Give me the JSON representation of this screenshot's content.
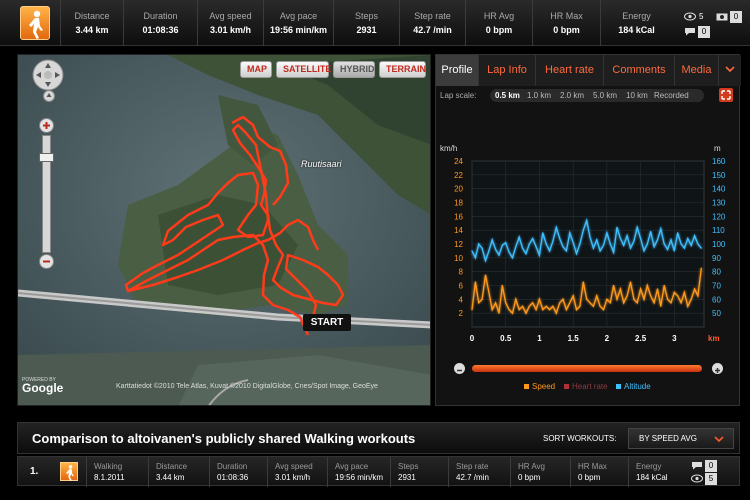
{
  "stats": [
    {
      "label": "Distance",
      "value": "3.44 km"
    },
    {
      "label": "Duration",
      "value": "01:08:36"
    },
    {
      "label": "Avg speed",
      "value": "3.01 km/h"
    },
    {
      "label": "Avg pace",
      "value": "19:56 min/km"
    },
    {
      "label": "Steps",
      "value": "2931"
    },
    {
      "label": "Step rate",
      "value": "42.7 /min"
    },
    {
      "label": "HR Avg",
      "value": "0 bpm"
    },
    {
      "label": "HR Max",
      "value": "0 bpm"
    },
    {
      "label": "Energy",
      "value": "184 kCal"
    }
  ],
  "social": {
    "views": "5",
    "photos": "0",
    "comments": "0"
  },
  "map": {
    "buttons": [
      "MAP",
      "SATELLITE",
      "HYBRID",
      "TERRAIN"
    ],
    "active_button": "HYBRID",
    "start_label": "START",
    "place_label": "Ruutisaari",
    "copyright": "Karttatiedot ©2010 Tele Atlas, Kuvat ©2010 DigitalGlobe, Cnes/Spot Image, GeoEye",
    "powered_by": "POWERED BY",
    "google": "Google"
  },
  "panel": {
    "tabs": [
      "Profile",
      "Lap Info",
      "Heart rate",
      "Comments",
      "Media"
    ],
    "active_tab": "Profile",
    "lap_scale_label": "Lap scale:",
    "lap_options": [
      "0.5 km",
      "1.0 km",
      "2.0 km",
      "5.0 km",
      "10 km",
      "Recorded"
    ],
    "active_lap": "0.5 km"
  },
  "colors": {
    "speed": "#ff9a1f",
    "heart_rate": "#b0303a",
    "altitude": "#3fc0ff",
    "accent": "#ff5a2a"
  },
  "chart_data": {
    "type": "line",
    "x_unit": "km",
    "left_unit": "km/h",
    "right_unit": "m",
    "xlim": [
      0,
      3.44
    ],
    "x_ticks": [
      "0",
      "0.5",
      "1",
      "1.5",
      "2",
      "2.5",
      "3"
    ],
    "left_ticks": [
      "24",
      "22",
      "20",
      "18",
      "16",
      "14",
      "12",
      "10",
      "8",
      "6",
      "4",
      "2"
    ],
    "right_ticks": [
      "160",
      "150",
      "140",
      "130",
      "120",
      "110",
      "100",
      "90",
      "80",
      "70",
      "60",
      "50"
    ],
    "left_range": [
      0,
      24
    ],
    "right_range": [
      40,
      160
    ],
    "grid": true,
    "series": [
      {
        "name": "Speed",
        "axis": "left",
        "x": [
          0,
          0.05,
          0.1,
          0.15,
          0.2,
          0.25,
          0.3,
          0.35,
          0.4,
          0.45,
          0.5,
          0.55,
          0.6,
          0.65,
          0.7,
          0.75,
          0.8,
          0.85,
          0.9,
          0.95,
          1.0,
          1.05,
          1.1,
          1.15,
          1.2,
          1.25,
          1.3,
          1.35,
          1.4,
          1.45,
          1.5,
          1.55,
          1.6,
          1.65,
          1.7,
          1.75,
          1.8,
          1.85,
          1.9,
          1.95,
          2.0,
          2.05,
          2.1,
          2.15,
          2.2,
          2.25,
          2.3,
          2.35,
          2.4,
          2.45,
          2.5,
          2.55,
          2.6,
          2.65,
          2.7,
          2.75,
          2.8,
          2.85,
          2.9,
          2.95,
          3.0,
          3.05,
          3.1,
          3.15,
          3.2,
          3.25,
          3.3,
          3.35,
          3.4
        ],
        "values": [
          2.5,
          6.5,
          3.5,
          4.0,
          7.5,
          5.0,
          2.5,
          3.5,
          2.0,
          6.0,
          3.5,
          2.5,
          2.0,
          4.0,
          2.5,
          3.0,
          2.0,
          3.0,
          3.5,
          2.5,
          4.0,
          2.5,
          3.0,
          2.5,
          3.0,
          2.0,
          3.5,
          4.0,
          2.5,
          3.5,
          4.5,
          2.5,
          3.0,
          6.5,
          4.0,
          3.5,
          3.0,
          4.5,
          3.0,
          2.5,
          4.0,
          3.5,
          6.0,
          4.0,
          5.5,
          3.5,
          4.5,
          6.5,
          4.0,
          3.5,
          5.5,
          4.0,
          6.0,
          4.5,
          3.5,
          5.5,
          3.0,
          6.0,
          4.0,
          3.5,
          5.0,
          4.5,
          3.5,
          5.0,
          3.0,
          4.0,
          5.5,
          4.5,
          8.5
        ]
      },
      {
        "name": "Heart rate",
        "axis": "left",
        "x": [],
        "values": []
      },
      {
        "name": "Altitude",
        "axis": "right",
        "x": [
          0,
          0.05,
          0.1,
          0.15,
          0.2,
          0.25,
          0.3,
          0.35,
          0.4,
          0.45,
          0.5,
          0.55,
          0.6,
          0.65,
          0.7,
          0.75,
          0.8,
          0.85,
          0.9,
          0.95,
          1.0,
          1.05,
          1.1,
          1.15,
          1.2,
          1.25,
          1.3,
          1.35,
          1.4,
          1.45,
          1.5,
          1.55,
          1.6,
          1.65,
          1.7,
          1.75,
          1.8,
          1.85,
          1.9,
          1.95,
          2.0,
          2.05,
          2.1,
          2.15,
          2.2,
          2.25,
          2.3,
          2.35,
          2.4,
          2.45,
          2.5,
          2.55,
          2.6,
          2.65,
          2.7,
          2.75,
          2.8,
          2.85,
          2.9,
          2.95,
          3.0,
          3.05,
          3.1,
          3.15,
          3.2,
          3.25,
          3.3,
          3.35,
          3.4
        ],
        "values": [
          95,
          90,
          100,
          97,
          88,
          95,
          103,
          96,
          92,
          99,
          101,
          94,
          90,
          98,
          105,
          97,
          93,
          100,
          104,
          98,
          92,
          108,
          100,
          95,
          102,
          112,
          104,
          98,
          95,
          108,
          101,
          93,
          100,
          110,
          117,
          105,
          97,
          103,
          95,
          99,
          108,
          100,
          94,
          112,
          104,
          99,
          106,
          97,
          102,
          112,
          104,
          95,
          100,
          109,
          98,
          103,
          111,
          100,
          96,
          103,
          95,
          108,
          100,
          97,
          104,
          99,
          106,
          100,
          97
        ]
      }
    ]
  },
  "comparison": {
    "title": "Comparison to altoivanen's publicly shared Walking workouts",
    "sort_label": "SORT WORKOUTS:",
    "sort_value": "BY SPEED AVG"
  },
  "workout_row": {
    "rank": "1.",
    "cells": [
      {
        "label": "Walking",
        "value": "8.1.2011"
      },
      {
        "label": "Distance",
        "value": "3.44 km"
      },
      {
        "label": "Duration",
        "value": "01:08:36"
      },
      {
        "label": "Avg speed",
        "value": "3.01 km/h"
      },
      {
        "label": "Avg pace",
        "value": "19:56 min/km"
      },
      {
        "label": "Steps",
        "value": "2931"
      },
      {
        "label": "Step rate",
        "value": "42.7 /min"
      },
      {
        "label": "HR Avg",
        "value": "0 bpm"
      },
      {
        "label": "HR Max",
        "value": "0 bpm"
      },
      {
        "label": "Energy",
        "value": "184 kCal"
      }
    ],
    "social": {
      "comments": "0",
      "views": "5"
    }
  }
}
